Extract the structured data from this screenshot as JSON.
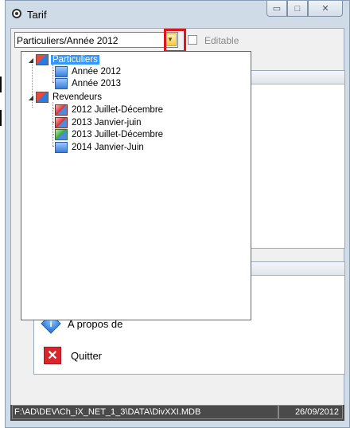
{
  "window": {
    "title": "Tarif",
    "buttons": {
      "minimize": "▭",
      "maximize": "□",
      "close": "✕"
    }
  },
  "toolbar": {
    "combo_value": "Particuliers/Année 2012",
    "editable_label": "Editable",
    "editable_checked": false
  },
  "tree": [
    {
      "label": "Particuliers",
      "level": 0,
      "expanded": true,
      "icon": "folder-tariff-icon",
      "selected": true
    },
    {
      "label": "Année 2012",
      "level": 1,
      "icon": "tariff-blue-icon"
    },
    {
      "label": "Année 2013",
      "level": 1,
      "icon": "tariff-blue-icon"
    },
    {
      "label": "Revendeurs",
      "level": 0,
      "expanded": true,
      "icon": "folder-tariff-icon"
    },
    {
      "label": "2012 Juillet-Décembre",
      "level": 1,
      "icon": "tariff-red-icon"
    },
    {
      "label": "2013 Janvier-juin",
      "level": 1,
      "icon": "tariff-red-icon"
    },
    {
      "label": "2013 Juillet-Décembre",
      "level": 1,
      "icon": "tariff-green-icon"
    },
    {
      "label": "2014 Janvier-Juin",
      "level": 1,
      "icon": "tariff-blue-icon"
    }
  ],
  "actions": {
    "about_label": "A propos de",
    "quit_label": "Quitter"
  },
  "status": {
    "path": "F:\\AD\\DEV\\Ch_iX_NET_1_3\\DATA\\DivXXI.MDB",
    "date": "26/09/2012"
  },
  "colors": {
    "highlight_box": "#e0141b",
    "selection": "#3399ff",
    "statusbar": "#4a4a4a"
  }
}
